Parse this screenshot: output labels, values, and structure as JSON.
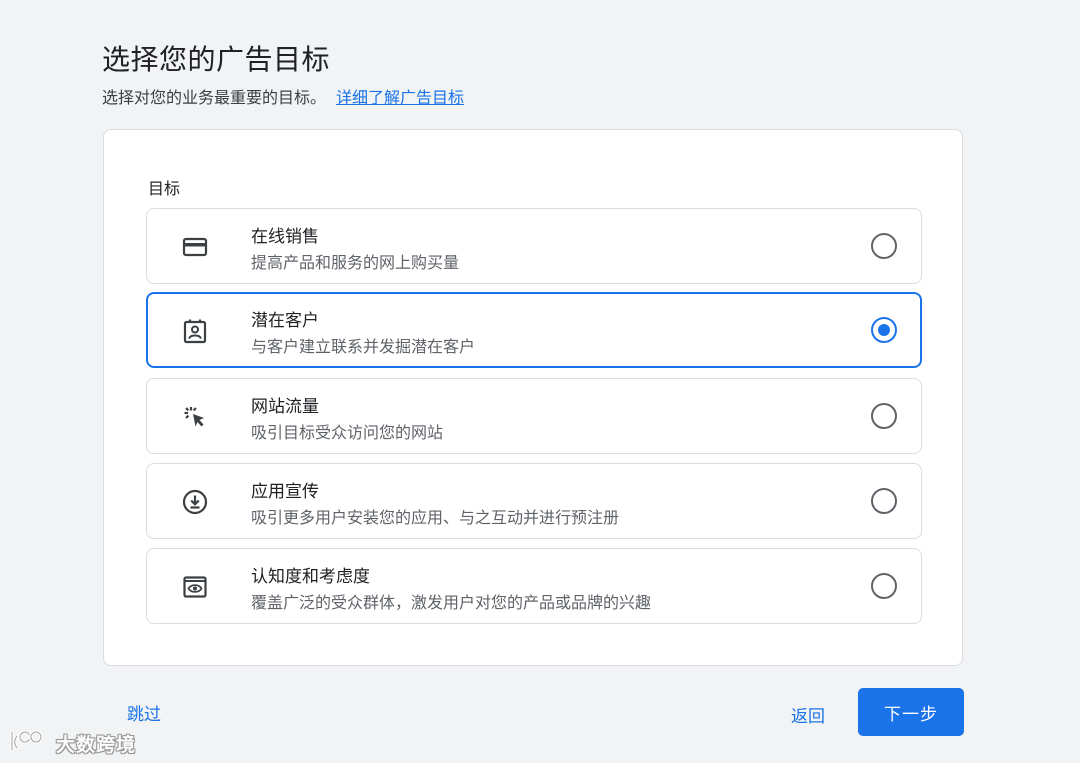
{
  "header": {
    "title": "选择您的广告目标",
    "subtitle": "选择对您的业务最重要的目标。",
    "learn_more_link": "详细了解广告目标"
  },
  "goals": {
    "section_label": "目标",
    "options": [
      {
        "title": "在线销售",
        "description": "提高产品和服务的网上购买量",
        "icon": "credit-card-icon",
        "selected": false
      },
      {
        "title": "潜在客户",
        "description": "与客户建立联系并发掘潜在客户",
        "icon": "contact-portrait-icon",
        "selected": true
      },
      {
        "title": "网站流量",
        "description": "吸引目标受众访问您的网站",
        "icon": "cursor-click-icon",
        "selected": false
      },
      {
        "title": "应用宣传",
        "description": "吸引更多用户安装您的应用、与之互动并进行预注册",
        "icon": "download-circle-icon",
        "selected": false
      },
      {
        "title": "认知度和考虑度",
        "description": "覆盖广泛的受众群体，激发用户对您的产品或品牌的兴趣",
        "icon": "eye-frame-icon",
        "selected": false
      }
    ]
  },
  "footer": {
    "skip_label": "跳过",
    "back_label": "返回",
    "next_label": "下一步"
  },
  "watermark": {
    "text": "大数跨境"
  },
  "colors": {
    "accent": "#1a73e8",
    "background": "#f1f3f4",
    "card": "#ffffff",
    "border": "#dadce0",
    "secondary_text": "#5f6368"
  }
}
